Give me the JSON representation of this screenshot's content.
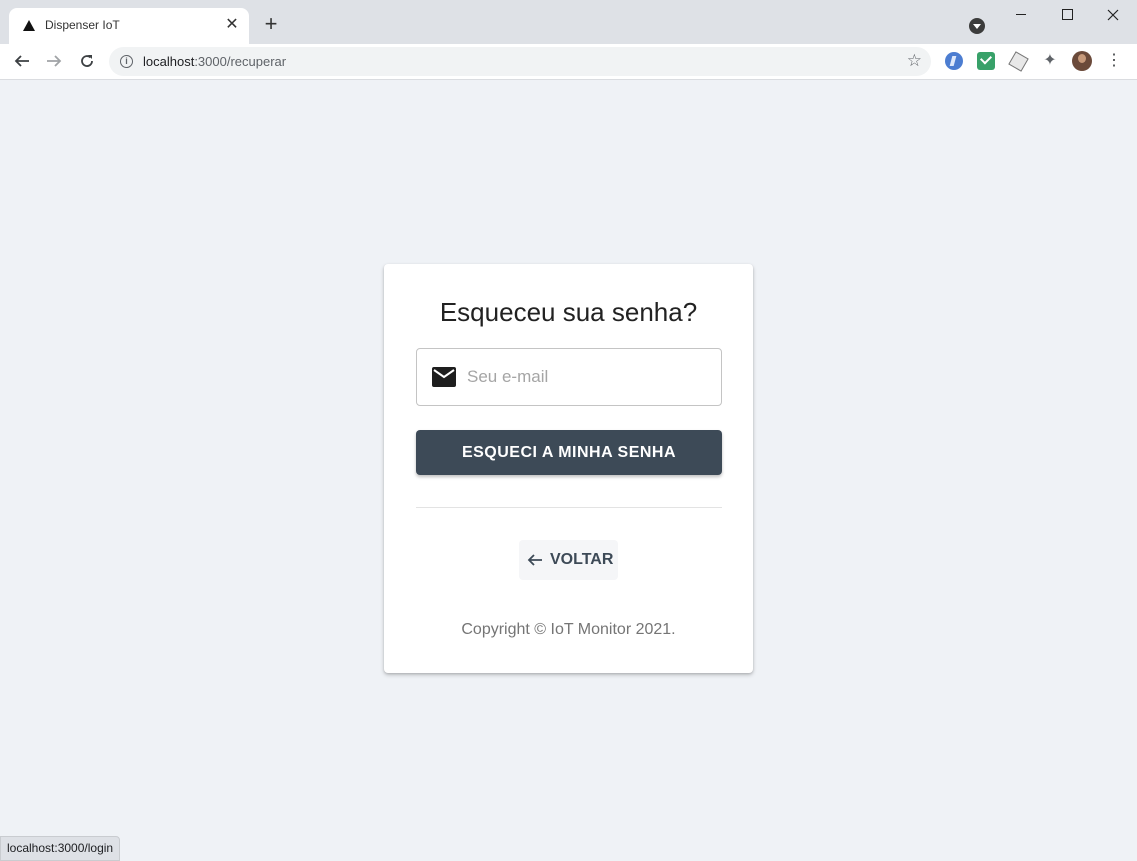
{
  "browser": {
    "tab_title": "Dispenser IoT",
    "tab_close": "✕",
    "new_tab": "+",
    "url_host": "localhost",
    "url_path": ":3000/recuperar",
    "menu_dots": "⋮"
  },
  "page": {
    "title": "Esqueceu sua senha?",
    "email_placeholder": "Seu e-mail",
    "submit_label": "ESQUECI A MINHA SENHA",
    "back_label": "VOLTAR",
    "copyright": "Copyright © IoT Monitor 2021."
  },
  "status_bar": {
    "text": "localhost:3000/login"
  }
}
